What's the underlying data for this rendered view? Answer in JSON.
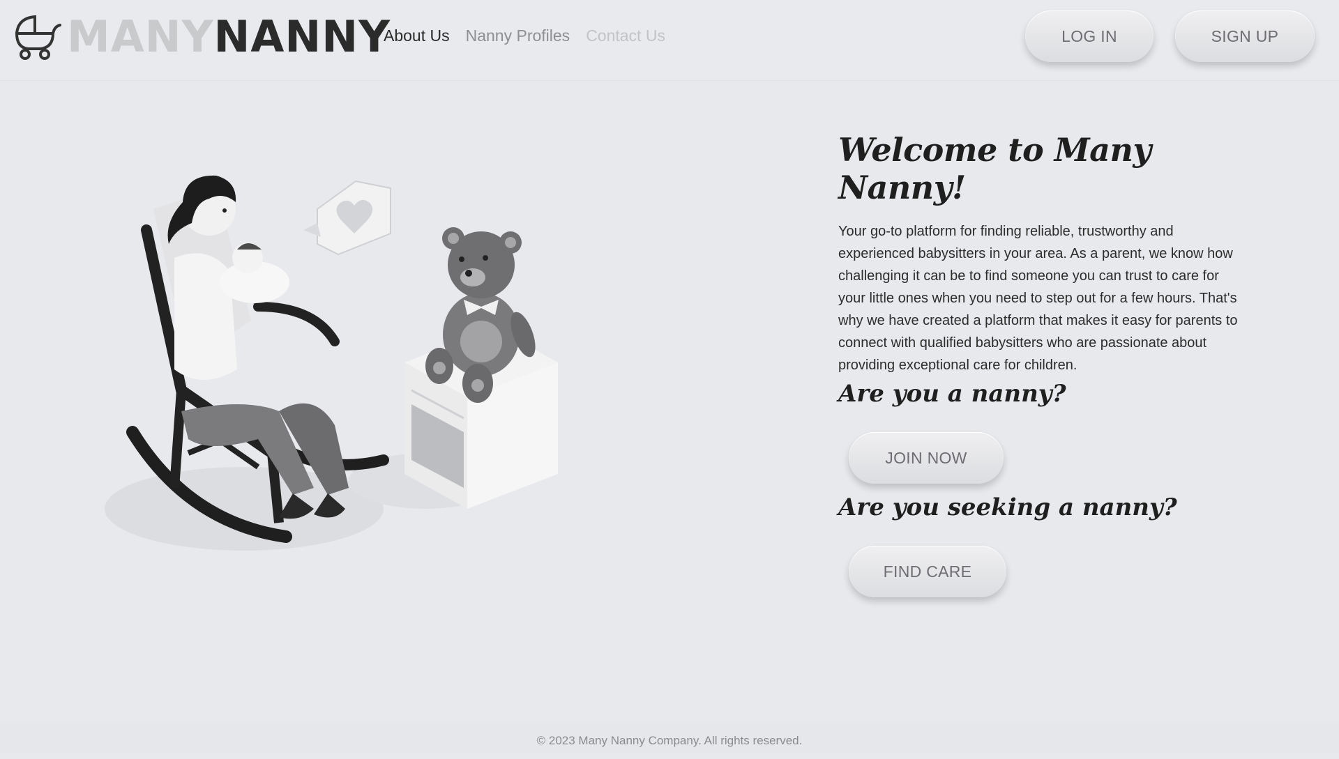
{
  "brand": {
    "many": "MANY",
    "nanny": "NANNY",
    "icon": "stroller-icon"
  },
  "nav": {
    "items": [
      {
        "label": "About Us"
      },
      {
        "label": "Nanny Profiles"
      },
      {
        "label": "Contact Us"
      }
    ]
  },
  "auth": {
    "login_label": "LOG IN",
    "signup_label": "SIGN UP"
  },
  "hero": {
    "title": "Welcome to Many Nanny!",
    "description": "Your go-to platform for finding reliable, trustworthy and experienced babysitters in your area. As a parent, we know how challenging it can be to find someone you can trust to care for your little ones when you need to step out for a few hours. That's why we have created a platform that makes it easy for parents to connect with qualified babysitters who are passionate about providing exceptional care for children.",
    "nanny_question": "Are you a nanny?",
    "join_label": "JOIN NOW",
    "seeker_question": "Are you seeking a nanny?",
    "find_label": "FIND CARE"
  },
  "footer": {
    "copyright": "© 2023 Many Nanny Company. All rights reserved."
  }
}
